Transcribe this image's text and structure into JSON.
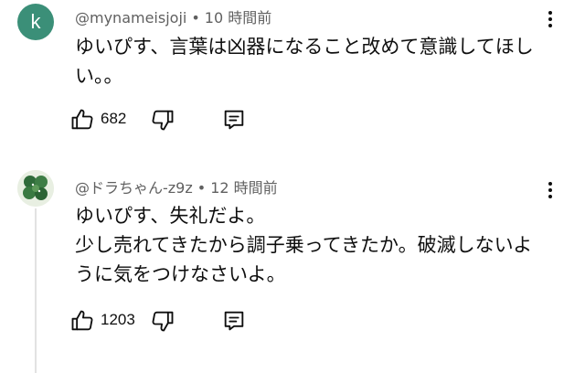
{
  "comments": [
    {
      "avatar_letter": "k",
      "avatar_color": "#3b8f78",
      "author": "@mynameisjoji",
      "separator": "•",
      "time": "10 時間前",
      "text": "ゆいぴす、言葉は凶器になること改めて意識してほし\nい。。",
      "likes": "682",
      "icons": {
        "like": "thumb-up-icon",
        "dislike": "thumb-down-icon",
        "reply": "comment-icon",
        "more": "more-vertical-icon"
      }
    },
    {
      "avatar_letter": "",
      "author": "@ドラちゃん-z9z",
      "separator": "•",
      "time": "12 時間前",
      "text": "ゆいぴす、失礼だよ。\n少し売れてきたから調子乗ってきたか。破滅しないよ\nうに気をつけなさいよ。",
      "likes": "1203",
      "icons": {
        "like": "thumb-up-icon",
        "dislike": "thumb-down-icon",
        "reply": "comment-icon",
        "more": "more-vertical-icon"
      }
    }
  ]
}
